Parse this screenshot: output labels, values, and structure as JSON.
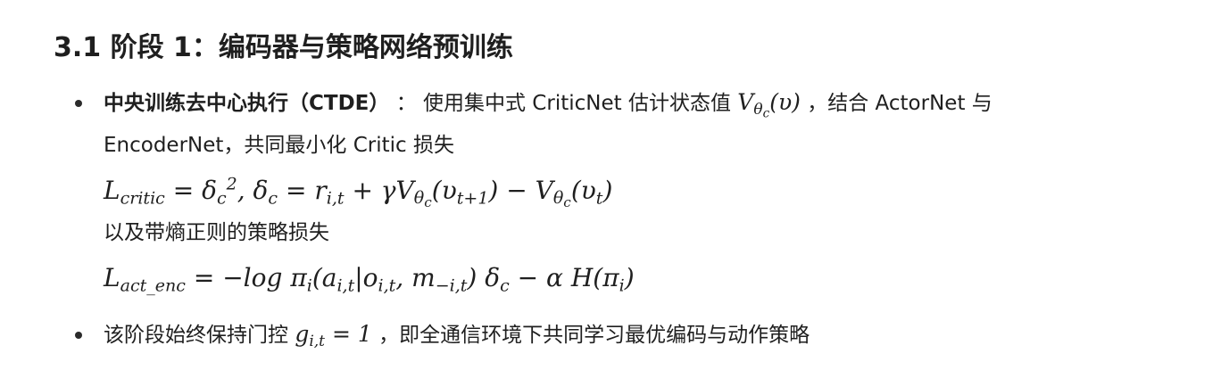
{
  "heading": {
    "number": "3.1",
    "title": "阶段 1：编码器与策略网络预训练"
  },
  "bullets": [
    {
      "label": "中央训练去中心执行（CTDE）",
      "separator": "：",
      "text_a": "使用集中式 CriticNet 估计状态值",
      "math_value": "V_θc(υ)",
      "text_b": "，结合 ActorNet 与",
      "text_c": "EncoderNet，共同最小化 Critic 损失",
      "critic_loss_formula": "L_critic = δ_c^2, δ_c = r_{i,t} + γV_θc(υ_{t+1}) − V_θc(υ_t)",
      "text_d": "以及带熵正则的策略损失",
      "policy_loss_formula": "L_act_enc = −log π_i(a_{i,t}|o_{i,t}, m_{−i,t}) δ_c − α H(π_i)"
    },
    {
      "text_a": "该阶段始终保持门控",
      "gate_formula": "g_{i,t} = 1",
      "text_b": "，即全通信环境下共同学习最优编码与动作策略"
    }
  ]
}
